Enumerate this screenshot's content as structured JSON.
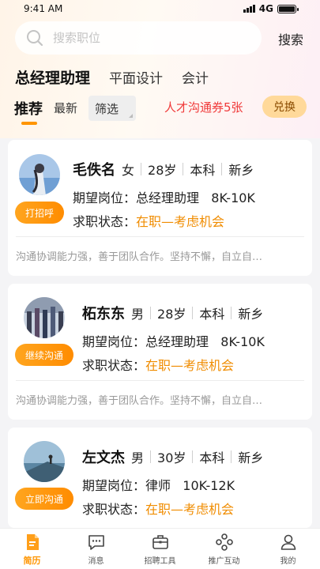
{
  "status_bar": {
    "time": "9:41 AM",
    "network": "4G"
  },
  "search": {
    "placeholder": "搜索职位",
    "button_label": "搜索"
  },
  "job_tabs": [
    {
      "label": "总经理助理",
      "active": true
    },
    {
      "label": "平面设计",
      "active": false
    },
    {
      "label": "会计",
      "active": false
    }
  ],
  "sort_tabs": [
    {
      "label": "推荐",
      "active": true
    },
    {
      "label": "最新",
      "active": false
    }
  ],
  "filter_label": "筛选",
  "coupon_text": "人才沟通券5张",
  "exchange_label": "兑换",
  "labels": {
    "expected_position": "期望岗位：",
    "job_status": "求职状态："
  },
  "candidates": [
    {
      "name": "毛佚名",
      "gender": "女",
      "age": "28岁",
      "education": "本科",
      "city": "新乡",
      "expected_position": "总经理助理",
      "salary": "8K-10K",
      "status": "在职—考虑机会",
      "action_label": "打招呼",
      "intro": "沟通协调能力强，善于团队合作。坚持不懈，自立自…"
    },
    {
      "name": "柘东东",
      "gender": "男",
      "age": "28岁",
      "education": "本科",
      "city": "新乡",
      "expected_position": "总经理助理",
      "salary": "8K-10K",
      "status": "在职—考虑机会",
      "action_label": "继续沟通",
      "intro": "沟通协调能力强，善于团队合作。坚持不懈，自立自…"
    },
    {
      "name": "左文杰",
      "gender": "男",
      "age": "30岁",
      "education": "本科",
      "city": "新乡",
      "expected_position": "律师",
      "salary": "10K-12K",
      "status": "在职—考虑机会",
      "action_label": "立即沟通"
    }
  ],
  "nav": [
    {
      "label": "简历",
      "icon": "resume-icon",
      "active": true
    },
    {
      "label": "消息",
      "icon": "message-icon",
      "active": false
    },
    {
      "label": "招聘工具",
      "icon": "briefcase-icon",
      "active": false
    },
    {
      "label": "推广互动",
      "icon": "promotion-icon",
      "active": false
    },
    {
      "label": "我的",
      "icon": "user-icon",
      "active": false
    }
  ],
  "colors": {
    "accent": "#ff9500",
    "coupon": "#f03a3a",
    "status_orange": "#f08c00"
  }
}
